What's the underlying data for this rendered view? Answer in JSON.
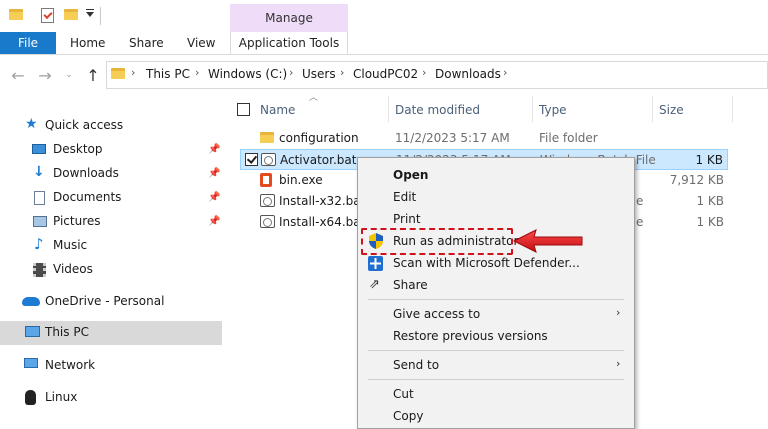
{
  "ribbon": {
    "tabs": {
      "file": "File",
      "home": "Home",
      "share": "Share",
      "view": "View"
    },
    "manage_group": "Manage",
    "app_tools_tab": "Application Tools"
  },
  "address": {
    "crumbs": [
      "This PC",
      "Windows (C:)",
      "Users",
      "CloudPC02",
      "Downloads"
    ]
  },
  "nav": {
    "items": [
      {
        "label": "Quick access",
        "icon": "star-icon"
      },
      {
        "label": "Desktop",
        "icon": "desktop-icon",
        "pinned": true
      },
      {
        "label": "Downloads",
        "icon": "download-icon",
        "pinned": true
      },
      {
        "label": "Documents",
        "icon": "documents-icon",
        "pinned": true
      },
      {
        "label": "Pictures",
        "icon": "pictures-icon",
        "pinned": true
      },
      {
        "label": "Music",
        "icon": "music-icon"
      },
      {
        "label": "Videos",
        "icon": "videos-icon"
      },
      {
        "label": "OneDrive - Personal",
        "icon": "cloud-icon"
      },
      {
        "label": "This PC",
        "icon": "computer-icon",
        "selected": true
      },
      {
        "label": "Network",
        "icon": "network-icon"
      },
      {
        "label": "Linux",
        "icon": "linux-icon"
      }
    ]
  },
  "columns": {
    "name": "Name",
    "date": "Date modified",
    "type": "Type",
    "size": "Size"
  },
  "files": [
    {
      "name": "configuration",
      "date": "11/2/2023 5:17 AM",
      "type": "File folder",
      "size": "",
      "icon": "folder-icon"
    },
    {
      "name": "Activator.bat",
      "date": "11/2/2023 5:17 AM",
      "type": "Windows Batch File",
      "size": "1 KB",
      "icon": "batch-file-icon",
      "selected": true
    },
    {
      "name": "bin.exe",
      "date": "",
      "type": "",
      "size": "7,912 KB",
      "icon": "exe-icon"
    },
    {
      "name": "Install-x32.bat",
      "date": "",
      "type": "e",
      "size": "1 KB",
      "icon": "batch-file-icon"
    },
    {
      "name": "Install-x64.bat",
      "date": "",
      "type": "e",
      "size": "1 KB",
      "icon": "batch-file-icon"
    }
  ],
  "context_menu": {
    "open": "Open",
    "edit": "Edit",
    "print": "Print",
    "run_as_admin": "Run as administrator",
    "scan_defender": "Scan with Microsoft Defender...",
    "share": "Share",
    "give_access": "Give access to",
    "restore_versions": "Restore previous versions",
    "send_to": "Send to",
    "cut": "Cut",
    "copy": "Copy"
  },
  "colors": {
    "file_tab": "#1979ca",
    "manage_bg": "#eedcf8",
    "selection": "#cce8ff",
    "annotation": "#d0121a"
  }
}
